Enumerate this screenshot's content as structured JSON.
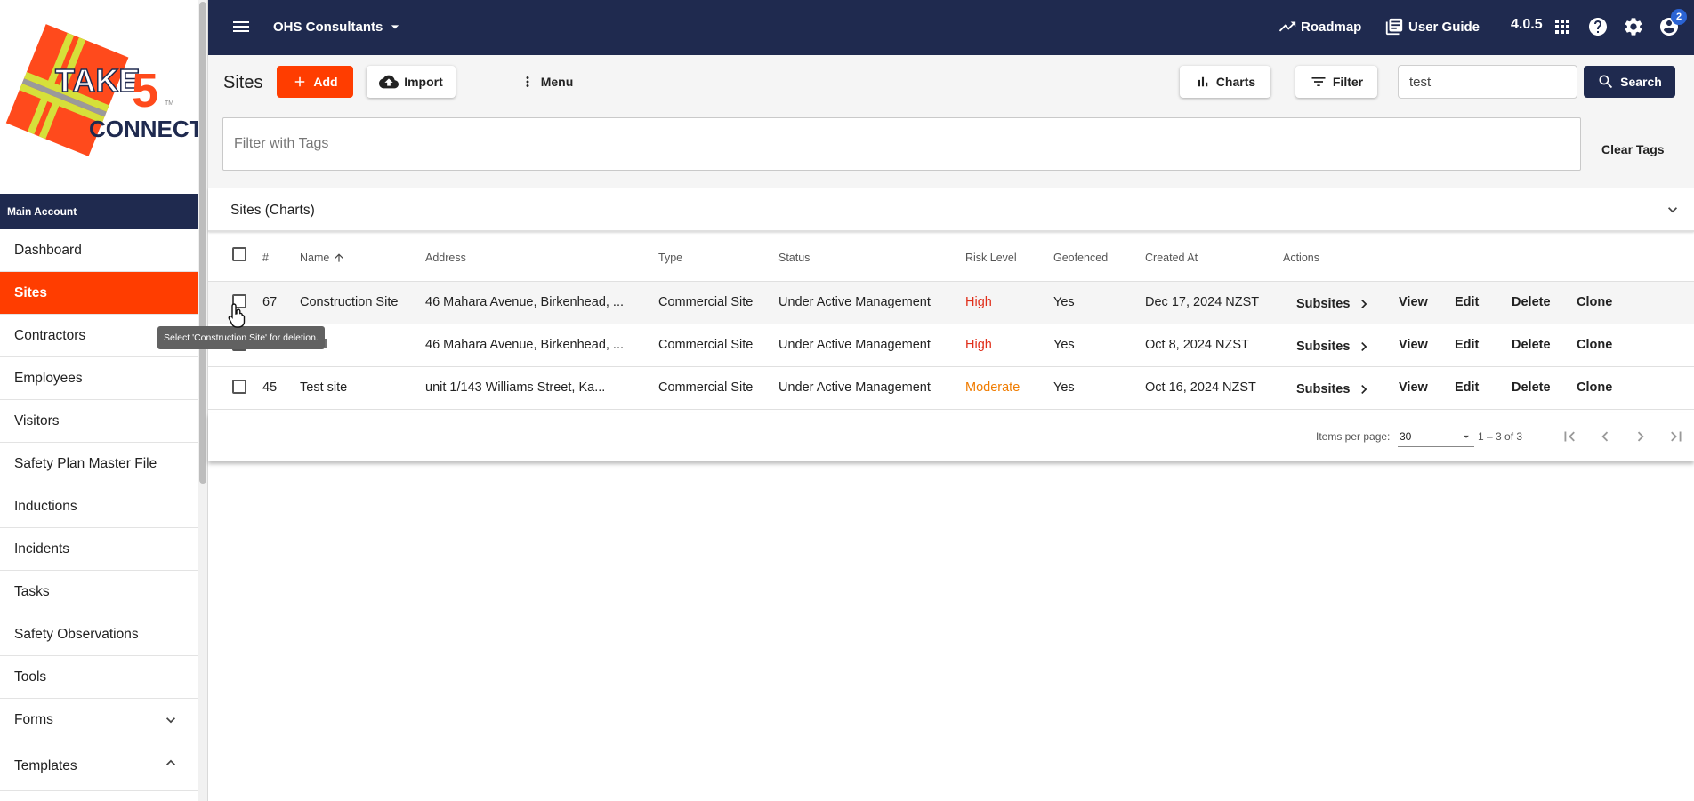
{
  "logo": {
    "line1": "TAKE",
    "digit": "5",
    "line2": "CONNECT",
    "tm": "TM"
  },
  "sidebar": {
    "account_label": "Main Account",
    "items": [
      {
        "label": "Dashboard"
      },
      {
        "label": "Sites",
        "active": true
      },
      {
        "label": "Contractors"
      },
      {
        "label": "Employees"
      },
      {
        "label": "Visitors"
      },
      {
        "label": "Safety Plan Master File"
      },
      {
        "label": "Inductions"
      },
      {
        "label": "Incidents"
      },
      {
        "label": "Tasks"
      },
      {
        "label": "Safety Observations"
      },
      {
        "label": "Tools"
      },
      {
        "label": "Forms",
        "expand": "chevron-down-icon"
      },
      {
        "label": "Templates",
        "expand": "chevron-up-icon"
      }
    ]
  },
  "topbar": {
    "org_name": "OHS Consultants",
    "roadmap_label": "Roadmap",
    "user_guide_label": "User Guide",
    "version": "4.0.5",
    "notification_count": "2",
    "colors": {
      "navy": "#1f2a4f",
      "accent": "#ff3d00"
    }
  },
  "toolbar": {
    "page_title": "Sites",
    "add_label": "Add",
    "import_label": "Import",
    "menu_label": "Menu",
    "charts_label": "Charts",
    "filter_label": "Filter",
    "search_value": "test",
    "search_label": "Search"
  },
  "tags": {
    "placeholder": "Filter with Tags",
    "clear_label": "Clear Tags"
  },
  "charts_panel": {
    "label": "Sites (Charts)"
  },
  "table": {
    "headers": {
      "num": "#",
      "name": "Name",
      "address": "Address",
      "type": "Type",
      "status": "Status",
      "risk": "Risk Level",
      "geofenced": "Geofenced",
      "created": "Created At",
      "actions": "Actions"
    },
    "actions": {
      "subsites": "Subsites",
      "view": "View",
      "edit": "Edit",
      "delete": "Delete",
      "clone": "Clone"
    },
    "rows": [
      {
        "id": "67",
        "name": "Construction Site",
        "address": "46 Mahara Avenue, Birkenhead, ...",
        "type": "Commercial Site",
        "status": "Under Active Management",
        "risk": "High",
        "geofenced": "Yes",
        "created": "Dec 17, 2024 NZST"
      },
      {
        "id": "",
        "name": "ionel",
        "address": "46 Mahara Avenue, Birkenhead, ...",
        "type": "Commercial Site",
        "status": "Under Active Management",
        "risk": "High",
        "geofenced": "Yes",
        "created": "Oct 8, 2024 NZST"
      },
      {
        "id": "45",
        "name": "Test site",
        "address": "unit 1/143 Williams Street, Ka...",
        "type": "Commercial Site",
        "status": "Under Active Management",
        "risk": "Moderate",
        "geofenced": "Yes",
        "created": "Oct 16, 2024 NZST"
      }
    ]
  },
  "paginator": {
    "items_label": "Items per page:",
    "page_size": "30",
    "range": "1 – 3 of 3"
  },
  "tooltip": {
    "text": "Select 'Construction Site' for deletion."
  }
}
